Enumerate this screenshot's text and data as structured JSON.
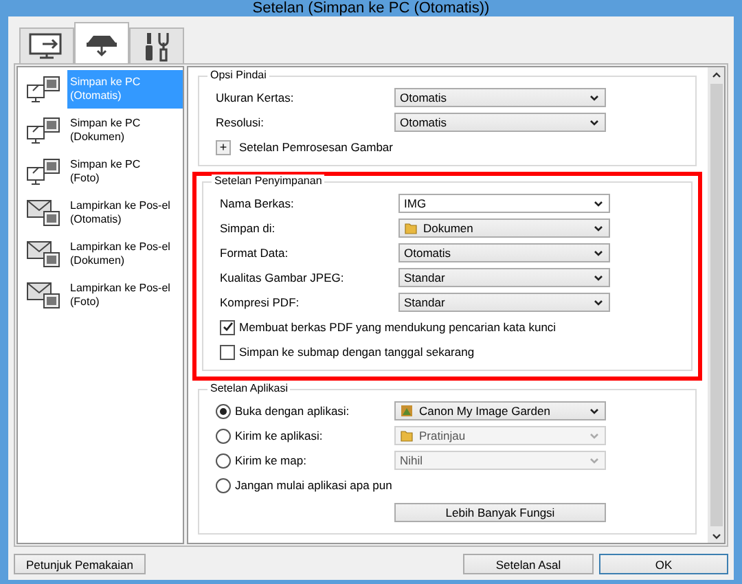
{
  "window": {
    "title": "Setelan (Simpan ke PC (Otomatis))"
  },
  "tabs": [
    {
      "kind": "pc",
      "selected": false
    },
    {
      "kind": "scanner",
      "selected": true
    },
    {
      "kind": "tools",
      "selected": false
    }
  ],
  "sidebar": {
    "items": [
      {
        "kind": "pc",
        "lines": [
          "Simpan ke PC",
          "(Otomatis)"
        ],
        "selected": true
      },
      {
        "kind": "pc",
        "lines": [
          "Simpan ke PC",
          "(Dokumen)"
        ],
        "selected": false
      },
      {
        "kind": "pc",
        "lines": [
          "Simpan ke PC",
          "(Foto)"
        ],
        "selected": false
      },
      {
        "kind": "mail",
        "lines": [
          "Lampirkan ke Pos-el",
          "(Otomatis)"
        ],
        "selected": false
      },
      {
        "kind": "mail",
        "lines": [
          "Lampirkan ke Pos-el",
          "(Dokumen)"
        ],
        "selected": false
      },
      {
        "kind": "mail",
        "lines": [
          "Lampirkan ke Pos-el",
          "(Foto)"
        ],
        "selected": false
      }
    ]
  },
  "scan_options": {
    "title": "Opsi Pindai",
    "fields": [
      {
        "label": "Ukuran Kertas:",
        "value": "Otomatis"
      },
      {
        "label": "Resolusi:",
        "value": "Otomatis"
      }
    ],
    "expander": {
      "symbol": "+",
      "label": "Setelan Pemrosesan Gambar"
    }
  },
  "save_settings": {
    "title": "Setelan Penyimpanan",
    "highlighted": true,
    "fields": [
      {
        "label": "Nama Berkas:",
        "value": "IMG"
      },
      {
        "label": "Simpan di:",
        "value": "Dokumen",
        "kind": "folder"
      },
      {
        "label": "Format Data:",
        "value": "Otomatis"
      },
      {
        "label": "Kualitas Gambar JPEG:",
        "value": "Standar"
      },
      {
        "label": "Kompresi PDF:",
        "value": "Standar"
      }
    ],
    "checkboxes": [
      {
        "label": "Membuat berkas PDF yang mendukung pencarian kata kunci",
        "checked": true
      },
      {
        "label": "Simpan ke submap dengan tanggal sekarang",
        "checked": false
      }
    ]
  },
  "app_settings": {
    "title": "Setelan Aplikasi",
    "options": [
      {
        "label": "Buka dengan aplikasi:",
        "selected": true,
        "value": "Canon My Image Garden",
        "kind": "app",
        "disabled": false
      },
      {
        "label": "Kirim ke aplikasi:",
        "selected": false,
        "value": "Pratinjau",
        "kind": "folder",
        "disabled": true
      },
      {
        "label": "Kirim ke map:",
        "selected": false,
        "value": "Nihil",
        "disabled": true
      },
      {
        "label": "Jangan mulai aplikasi apa pun",
        "selected": false
      }
    ],
    "button": "Lebih Banyak Fungsi"
  },
  "buttons": {
    "help": "Petunjuk Pemakaian",
    "defaults": "Setelan Asal",
    "ok": "OK"
  }
}
